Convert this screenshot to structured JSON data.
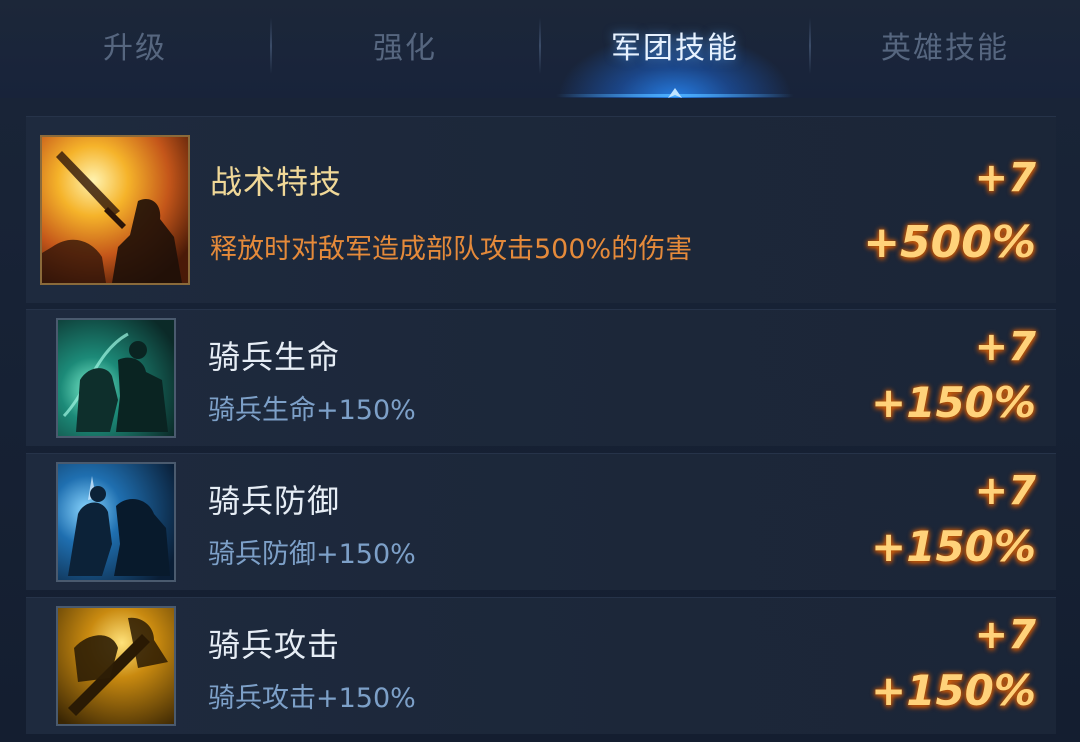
{
  "tabs": [
    {
      "label": "升级",
      "active": false
    },
    {
      "label": "强化",
      "active": false
    },
    {
      "label": "军团技能",
      "active": true
    },
    {
      "label": "英雄技能",
      "active": false
    }
  ],
  "skills": [
    {
      "name": "战术特技",
      "description": "释放时对敌军造成部队攻击500%的伤害",
      "level_bonus": "+7",
      "value_bonus": "+500%",
      "icon": "tactical-strike-icon"
    },
    {
      "name": "骑兵生命",
      "description": "骑兵生命+150%",
      "level_bonus": "+7",
      "value_bonus": "+150%",
      "icon": "cavalry-health-icon"
    },
    {
      "name": "骑兵防御",
      "description": "骑兵防御+150%",
      "level_bonus": "+7",
      "value_bonus": "+150%",
      "icon": "cavalry-defense-icon"
    },
    {
      "name": "骑兵攻击",
      "description": "骑兵攻击+150%",
      "level_bonus": "+7",
      "value_bonus": "+150%",
      "icon": "cavalry-attack-icon"
    }
  ],
  "colors": {
    "background": "#152033",
    "active_tab": "#e7f2ff",
    "inactive_tab": "#56667f",
    "bonus": "#ffd27a",
    "feature_desc": "#e58a3a",
    "normal_desc": "#7da0c8"
  }
}
